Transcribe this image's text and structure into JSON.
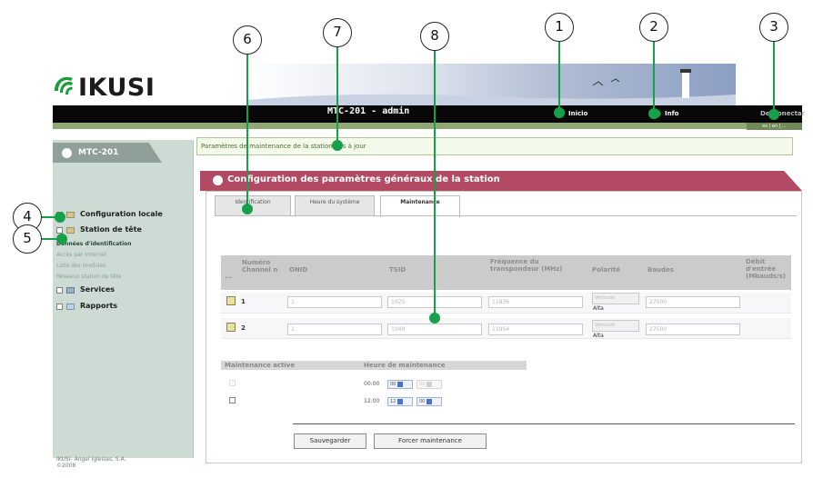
{
  "header": {
    "logo_text": "IKUSI",
    "title": "MTC-201 - admin",
    "links": {
      "start": "Inicio",
      "info": "Info",
      "logout": "Desconectar"
    },
    "languages": "es | en | ..."
  },
  "sidebar": {
    "tab_label": "MTC-201",
    "items": [
      {
        "label": "Configuration locale"
      },
      {
        "label": "Station de tête"
      },
      {
        "label": "Services"
      },
      {
        "label": "Rapports"
      }
    ],
    "subitems": [
      "Données d'identification",
      "Accès par Internet",
      "Liste des modules",
      "Réseaux station de tête"
    ],
    "footer": "IKUSI- Ángel Iglesias, S.A. ©2008"
  },
  "status": {
    "message": "Paramètres de maintenance de la station mis à jour"
  },
  "panel": {
    "title": "Configuration des paramètres généraux de la station",
    "tabs": [
      "Identification",
      "Heure du système",
      "Maintenance"
    ],
    "active_tab": "Maintenance"
  },
  "table": {
    "headers": [
      "Numéro Channel n",
      "ONID",
      "TSID",
      "Fréquence du transpondeur (MHz)",
      "Polarité",
      "Baudes",
      "Débit d'entrée (Mbauds/s)"
    ],
    "rows": [
      {
        "num": "1",
        "onid": "1",
        "tsid": "1025",
        "freq": "11836",
        "polarity": "Verticale",
        "polarity_sub": "Alta",
        "baud": "27500"
      },
      {
        "num": "2",
        "onid": "1",
        "tsid": "1049",
        "freq": "11954",
        "polarity": "Verticale",
        "polarity_sub": "Alta",
        "baud": "27500"
      }
    ]
  },
  "maintenance": {
    "headers": [
      "Maintenance active",
      "Heure de maintenance"
    ],
    "rows": [
      {
        "time": "00:00",
        "hour": "00",
        "minute": "00"
      },
      {
        "time": "12:00",
        "hour": "12",
        "minute": "00"
      }
    ],
    "save_label": "Sauvegarder",
    "force_label": "Forcer maintenance"
  },
  "callouts": [
    "1",
    "2",
    "3",
    "4",
    "5",
    "6",
    "7",
    "8"
  ],
  "colors": {
    "accent_green": "#16a049",
    "config_bar": "#b24a63",
    "sidebar_bg": "#cddbd4"
  }
}
